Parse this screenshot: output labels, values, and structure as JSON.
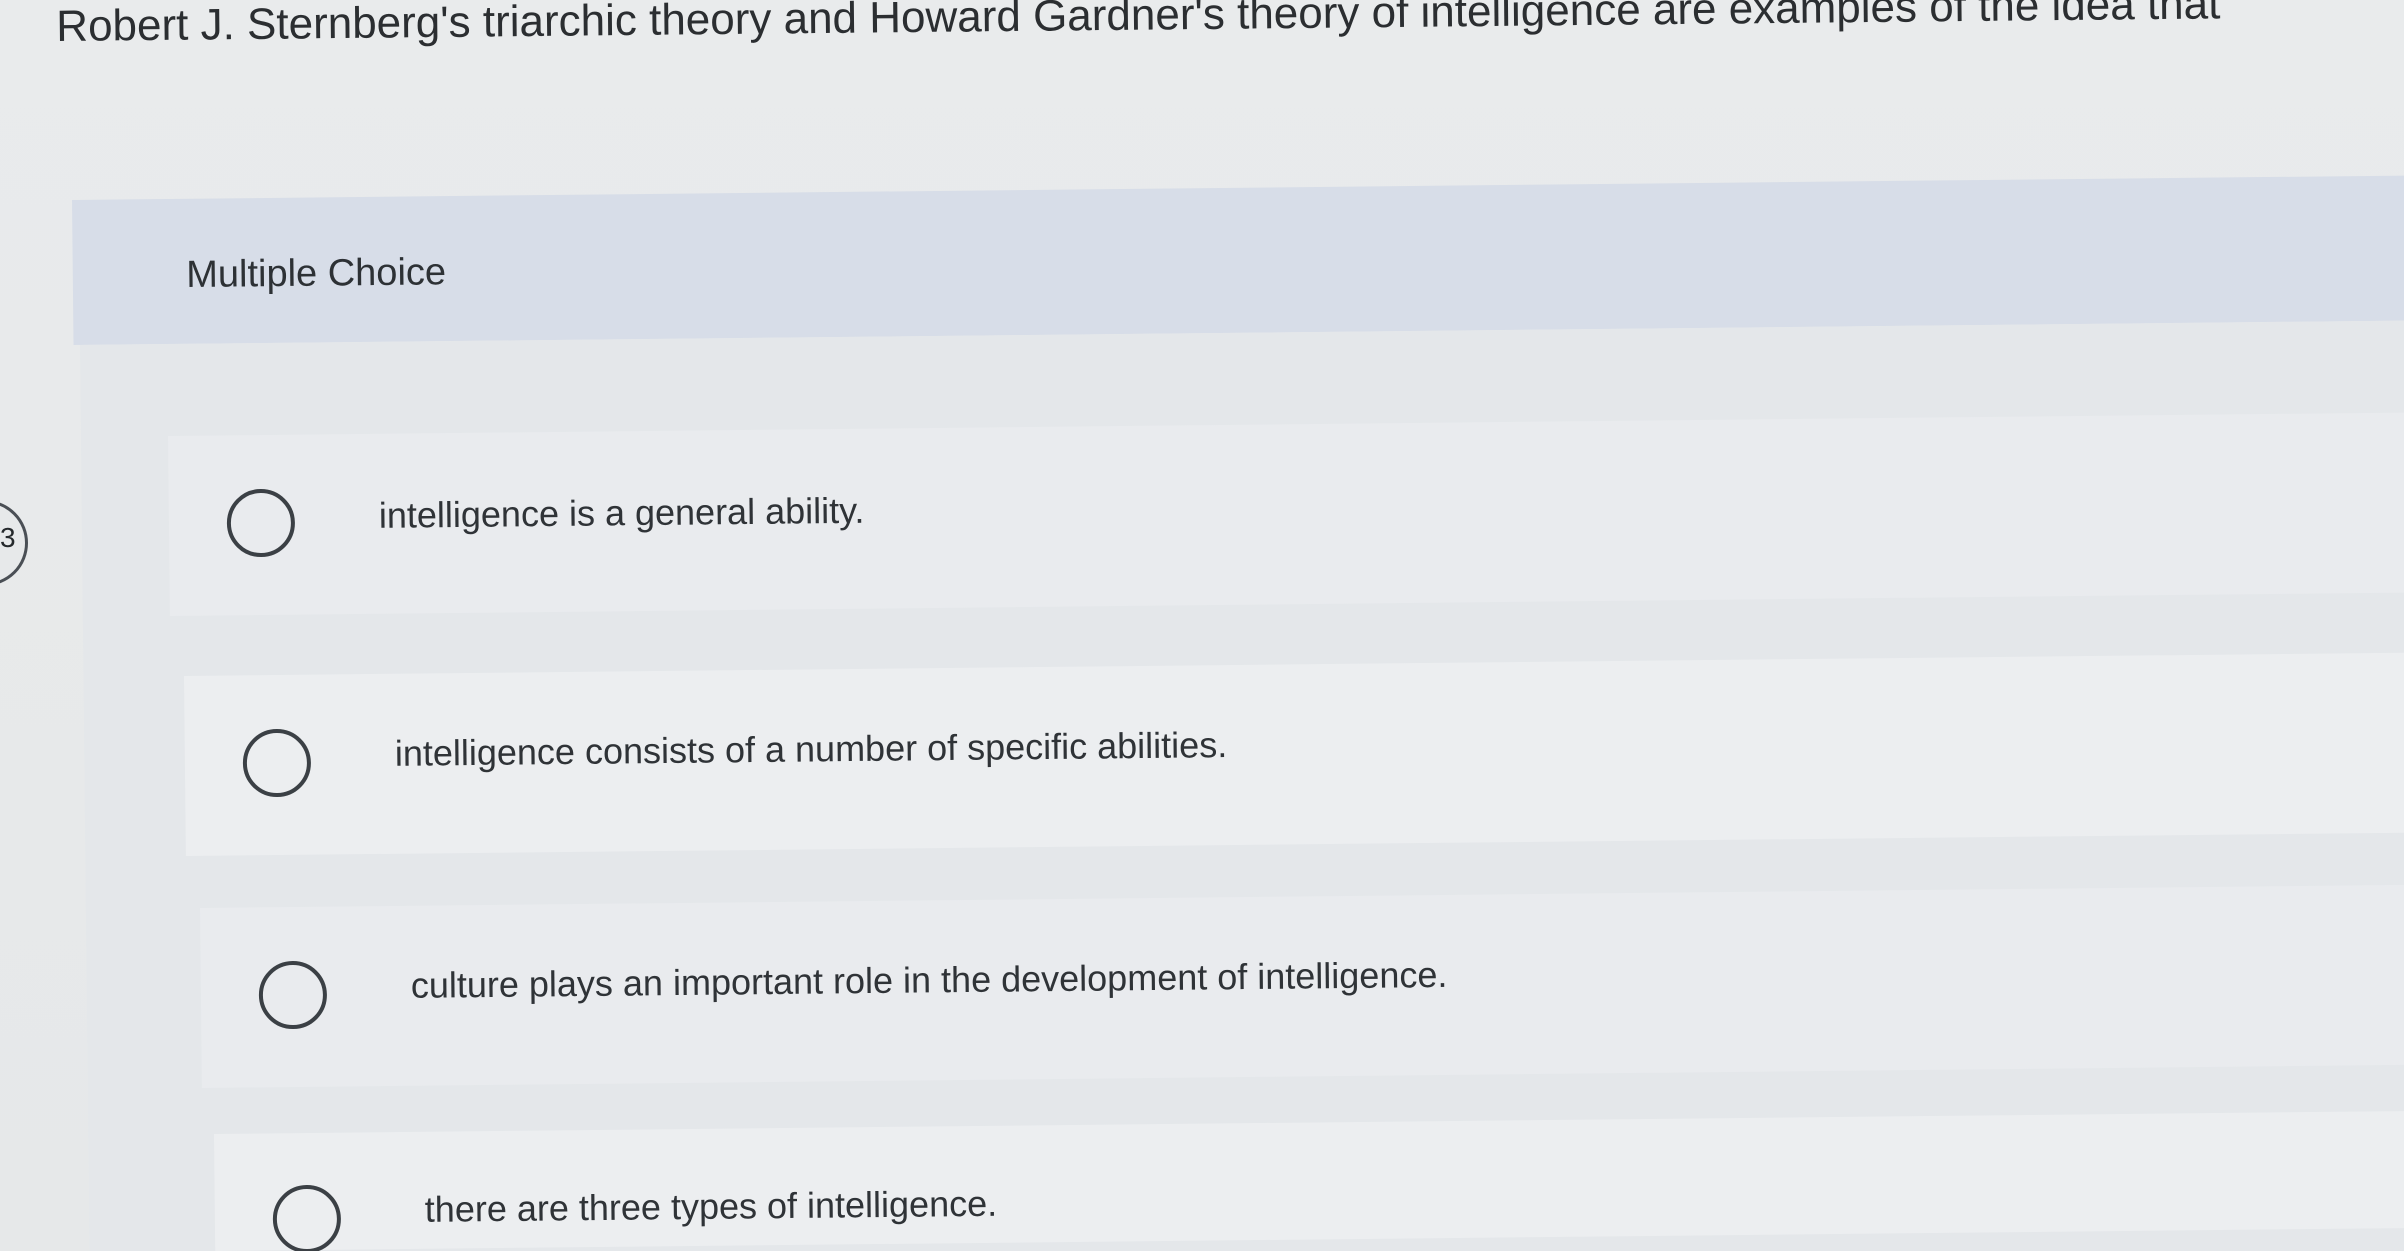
{
  "question": {
    "text": "Robert J. Sternberg's triarchic theory and Howard Gardner's theory of intelligence are examples of the idea that"
  },
  "question_type": {
    "label": "Multiple Choice"
  },
  "choices": [
    {
      "label": "intelligence is a general ability."
    },
    {
      "label": "intelligence consists of a number of specific abilities."
    },
    {
      "label": "culture plays an important role in the development of intelligence."
    },
    {
      "label": "there are three types of intelligence."
    }
  ],
  "edge_tab": {
    "text": "3"
  },
  "colors": {
    "background": "#e7e9ea",
    "panel": "#d7dde8",
    "text": "#2f3336",
    "radio_border": "#3b4045"
  },
  "icons": {
    "radio": "radio-button-unselected-icon"
  }
}
